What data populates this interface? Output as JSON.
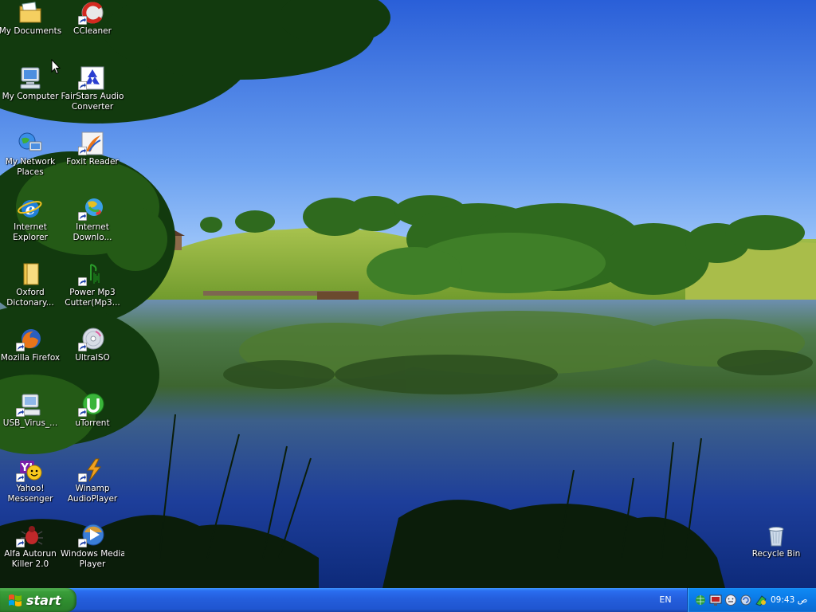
{
  "desktop": {
    "icons": {
      "my_documents": "My Documents",
      "ccleaner": "CCleaner",
      "my_computer": "My Computer",
      "fairstars_line1": "FairStars Audio",
      "fairstars_line2": "Converter",
      "my_network_line1": "My Network",
      "my_network_line2": "Places",
      "foxit_reader": "Foxit Reader",
      "internet_explorer_line1": "Internet",
      "internet_explorer_line2": "Explorer",
      "internet_download_line1": "Internet",
      "internet_download_line2": "Downlo...",
      "oxford_line1": "Oxford",
      "oxford_line2": "Dictonary...",
      "power_mp3_line1": "Power Mp3",
      "power_mp3_line2": "Cutter(Mp3...",
      "mozilla_firefox": "Mozilla Firefox",
      "ultraiso": "UltraISO",
      "usb_virus": "USB_Virus_...",
      "utorrent": "uTorrent",
      "yahoo_line1": "Yahoo!",
      "yahoo_line2": "Messenger",
      "winamp_line1": "Winamp",
      "winamp_line2": "AudioPlayer",
      "alfa_line1": "Alfa Autorun",
      "alfa_line2": "Killer 2.0",
      "wmp_line1": "Windows Media",
      "wmp_line2": "Player",
      "recycle_bin": "Recycle Bin"
    }
  },
  "taskbar": {
    "start_label": "start",
    "language": "EN",
    "clock": "09:43 ص"
  },
  "colors": {
    "taskbar_blue": "#245edc",
    "start_green": "#3a9e3a",
    "tray_blue": "#0b78e5",
    "sky_top": "#2f64d8",
    "sky_horizon": "#b6d8ff"
  }
}
